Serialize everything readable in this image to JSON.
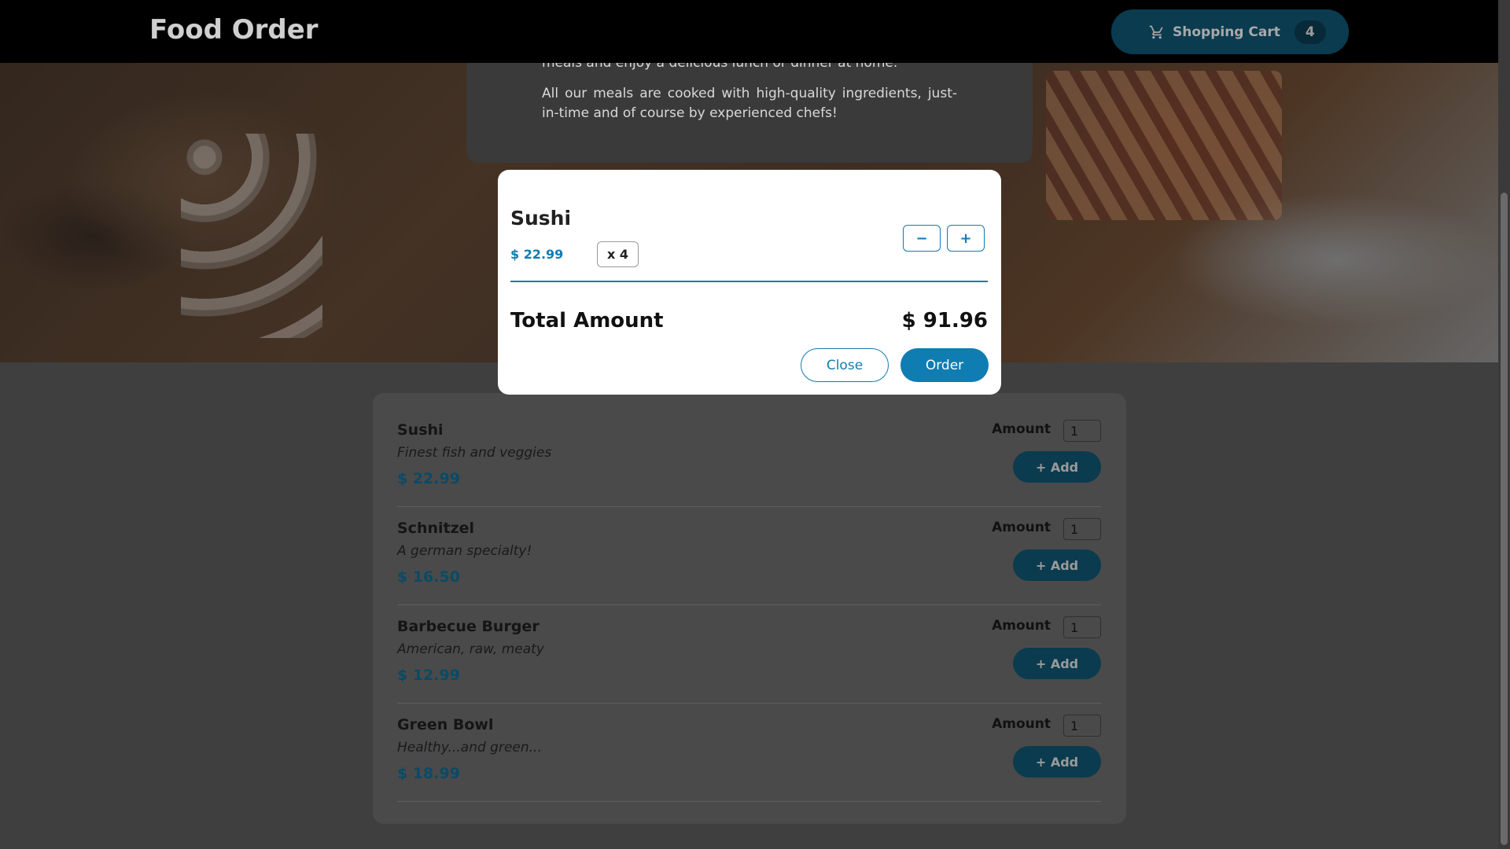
{
  "header": {
    "title": "Food Order",
    "cart_label": "Shopping Cart",
    "cart_count": "4"
  },
  "intro": {
    "partial_line": "meals and enjoy a delicious lunch or dinner at home.",
    "paragraph": "All our meals are cooked with high-quality ingredients, just-in-time and of course by experienced chefs!"
  },
  "meals": [
    {
      "name": "Sushi",
      "description": "Finest fish and veggies",
      "price": "$ 22.99",
      "amount_label": "Amount",
      "amount": "1",
      "add_label": "+ Add"
    },
    {
      "name": "Schnitzel",
      "description": "A german specialty!",
      "price": "$ 16.50",
      "amount_label": "Amount",
      "amount": "1",
      "add_label": "+ Add"
    },
    {
      "name": "Barbecue Burger",
      "description": "American, raw, meaty",
      "price": "$ 12.99",
      "amount_label": "Amount",
      "amount": "1",
      "add_label": "+ Add"
    },
    {
      "name": "Green Bowl",
      "description": "Healthy...and green...",
      "price": "$ 18.99",
      "amount_label": "Amount",
      "amount": "1",
      "add_label": "+ Add"
    }
  ],
  "modal": {
    "item": {
      "name": "Sushi",
      "price": "$ 22.99",
      "quantity": "x 4"
    },
    "minus_label": "−",
    "plus_label": "+",
    "total_label": "Total Amount",
    "total_value": "$ 91.96",
    "close_label": "Close",
    "order_label": "Order"
  },
  "colors": {
    "accent": "#0f7cb2",
    "header_bg": "#000000"
  },
  "icons": {
    "cart": "shopping-cart-icon"
  }
}
